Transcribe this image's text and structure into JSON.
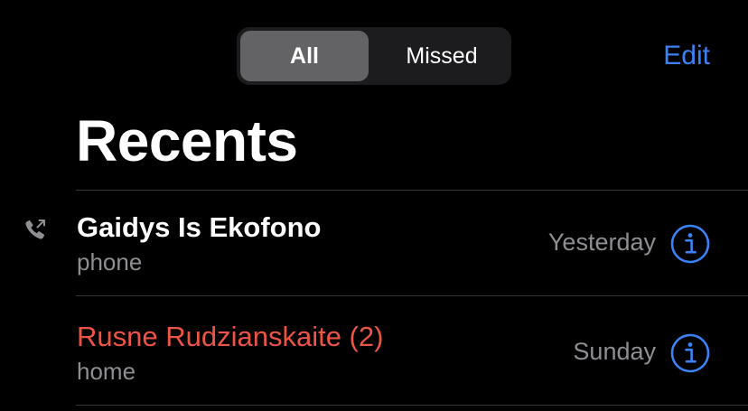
{
  "segmented_control": {
    "options": [
      "All",
      "Missed"
    ],
    "selected": "All"
  },
  "nav": {
    "edit_label": "Edit"
  },
  "page": {
    "title": "Recents"
  },
  "calls": [
    {
      "name": "Gaidys Is Ekofono",
      "label": "phone",
      "time": "Yesterday",
      "missed": false,
      "outgoing": true
    },
    {
      "name": "Rusne Rudzianskaite (2)",
      "label": "home",
      "time": "Sunday",
      "missed": true,
      "outgoing": false
    }
  ],
  "colors": {
    "background": "#000000",
    "accent_blue": "#3b82f6",
    "missed_red": "#eb5545",
    "secondary_text": "#8e8e93",
    "segment_selected": "#636366",
    "segment_track": "#1c1c1e"
  },
  "icons": {
    "outgoing_call": "outgoing-call-icon",
    "info": "info-icon"
  }
}
